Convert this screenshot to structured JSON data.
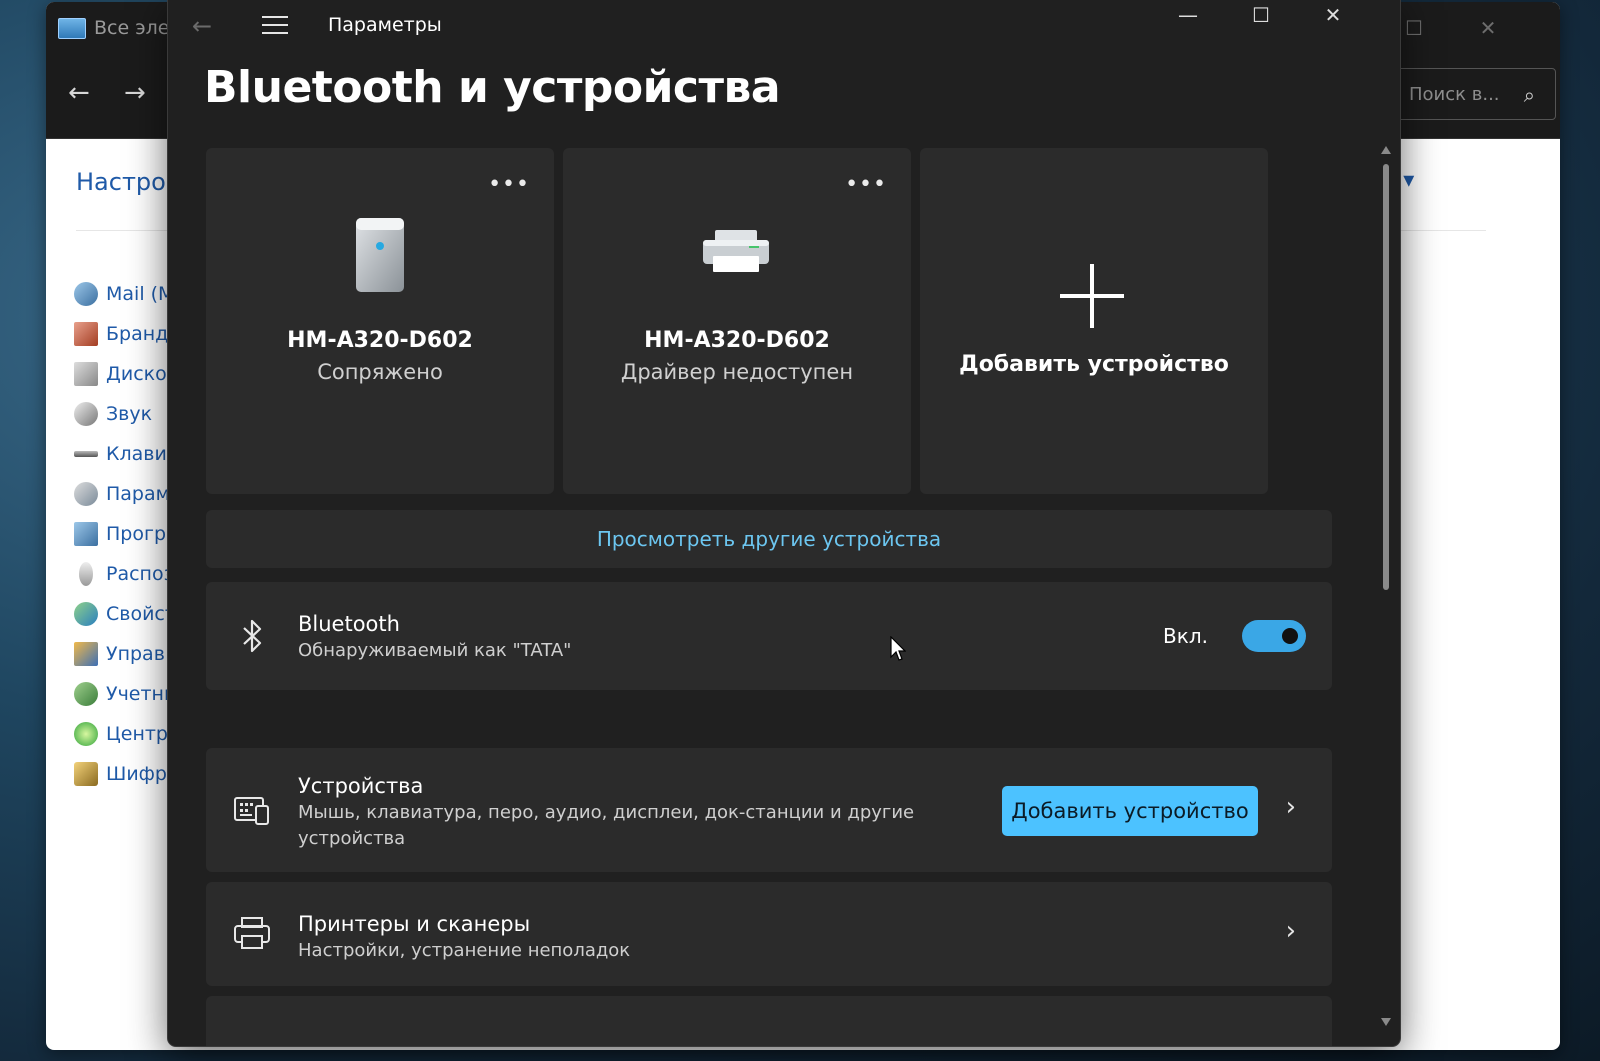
{
  "background_window": {
    "tab_title": "Все элем",
    "search_placeholder": "Поиск в...",
    "heading": "Настрой",
    "right_link": "и ▾",
    "items": [
      {
        "label": "Mail (M"
      },
      {
        "label": "Бранд"
      },
      {
        "label": "Диско"
      },
      {
        "label": "Звук"
      },
      {
        "label": "Клави"
      },
      {
        "label": "Парам"
      },
      {
        "label": "Прогр"
      },
      {
        "label": "Распоз"
      },
      {
        "label": "Свойст"
      },
      {
        "label": "Управ"
      },
      {
        "label": "Учетны"
      },
      {
        "label": "Центр"
      },
      {
        "label": "Шифро"
      }
    ]
  },
  "settings": {
    "window_title": "Параметры",
    "page_title": "Bluetooth и устройства",
    "device_cards": [
      {
        "name": "HM-A320-D602",
        "status": "Сопряжено",
        "icon": "speaker-icon"
      },
      {
        "name": "HM-A320-D602",
        "status": "Драйвер недоступен",
        "icon": "printer-icon"
      }
    ],
    "add_device_card": {
      "label": "Добавить устройство",
      "icon": "plus-icon"
    },
    "view_more": "Просмотреть другие устройства",
    "bluetooth": {
      "title": "Bluetooth",
      "subtitle": "Обнаруживаемый как \"TATA\"",
      "toggle_label": "Вкл.",
      "enabled": true
    },
    "devices_row": {
      "title": "Устройства",
      "subtitle_line1": "Мышь, клавиатура, перо, аудио, дисплеи, док-станции и другие",
      "subtitle_line2": "устройства",
      "button": "Добавить устройство"
    },
    "printers_row": {
      "title": "Принтеры и сканеры",
      "subtitle": "Настройки, устранение неполадок"
    }
  },
  "colors": {
    "accent": "#4cc2ff",
    "toggle_on": "#3aa7e6",
    "link": "#6cc6f0",
    "card_bg": "#2b2b2b",
    "window_bg": "#202020"
  }
}
